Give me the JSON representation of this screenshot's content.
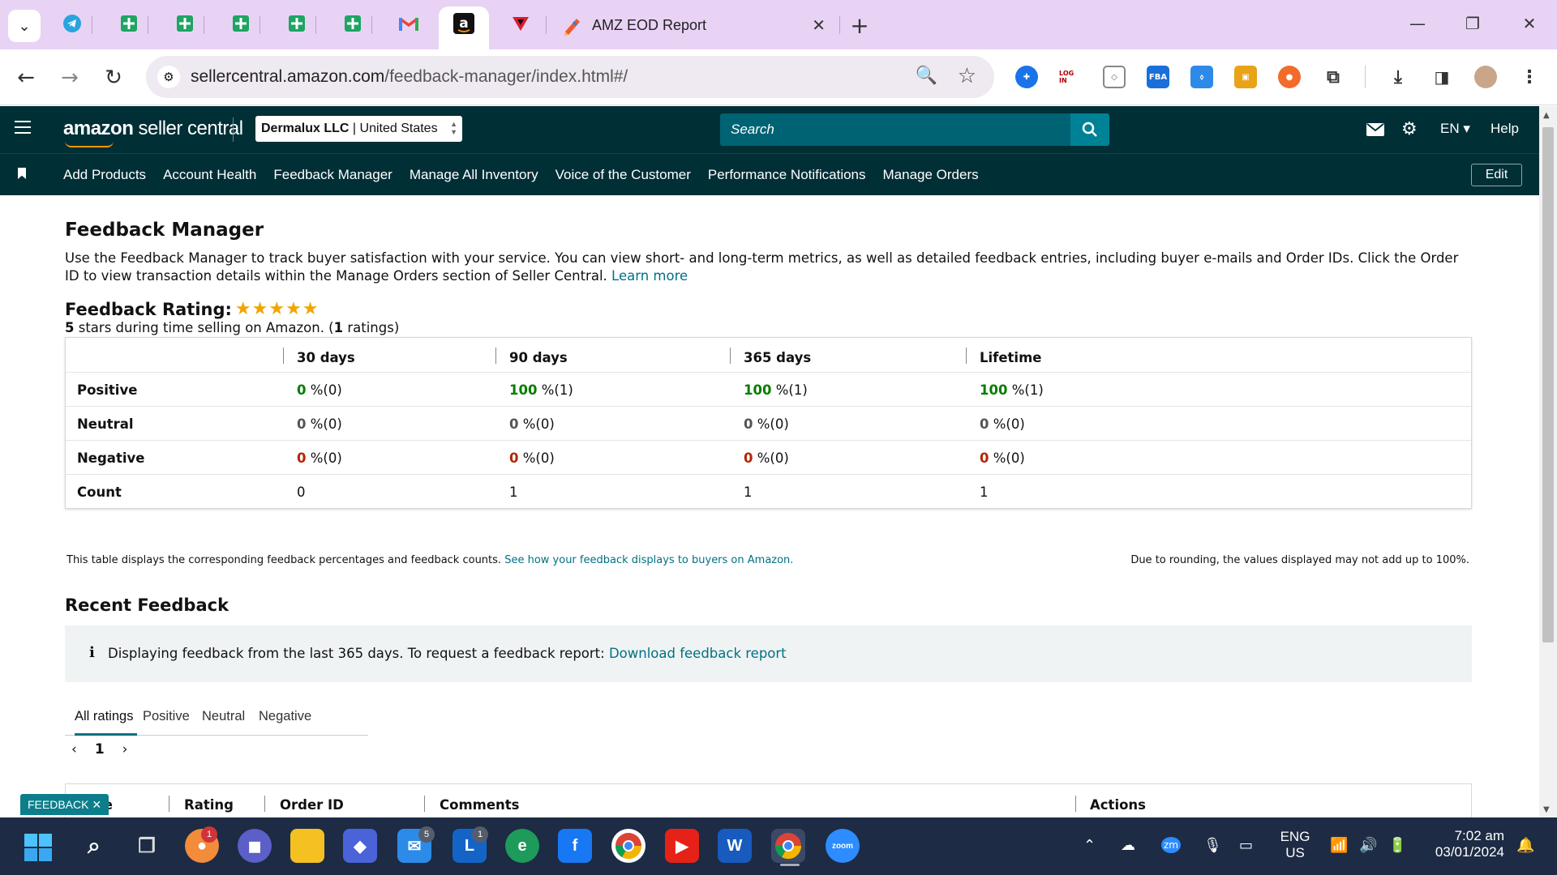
{
  "browser": {
    "active_tab_title": "AMZ EOD Report",
    "url_domain": "sellercentral.amazon.com",
    "url_path": "/feedback-manager/index.html#/"
  },
  "header": {
    "logo_brand": "amazon",
    "logo_product": "seller central",
    "account_name": "Dermalux LLC",
    "account_region": "| United States",
    "search_placeholder": "Search",
    "language": "EN",
    "help": "Help"
  },
  "nav": {
    "links": [
      "Add Products",
      "Account Health",
      "Feedback Manager",
      "Manage All Inventory",
      "Voice of the Customer",
      "Performance Notifications",
      "Manage Orders"
    ],
    "edit": "Edit"
  },
  "page": {
    "title": "Feedback Manager",
    "description": "Use the Feedback Manager to track buyer satisfaction with your service. You can view short- and long-term metrics, as well as detailed feedback entries, including buyer e-mails and Order IDs. Click the Order ID to view transaction details within the Manage Orders section of Seller Central.",
    "learn_more": "Learn more",
    "rating_label": "Feedback Rating:",
    "rating_stars": 5,
    "rating_sub_stars": "5",
    "rating_sub_text": "stars during time selling on Amazon. (",
    "rating_sub_count": "1",
    "rating_sub_end": "ratings)"
  },
  "table": {
    "columns": [
      "30 days",
      "90 days",
      "365 days",
      "Lifetime"
    ],
    "rows": [
      {
        "label": "Positive",
        "values": [
          {
            "n": "0",
            "rest": "%(0)"
          },
          {
            "n": "100",
            "rest": "%(1)"
          },
          {
            "n": "100",
            "rest": "%(1)"
          },
          {
            "n": "100",
            "rest": "%(1)"
          }
        ]
      },
      {
        "label": "Neutral",
        "values": [
          {
            "n": "0",
            "rest": "%(0)"
          },
          {
            "n": "0",
            "rest": "%(0)"
          },
          {
            "n": "0",
            "rest": "%(0)"
          },
          {
            "n": "0",
            "rest": "%(0)"
          }
        ]
      },
      {
        "label": "Negative",
        "values": [
          {
            "n": "0",
            "rest": "%(0)"
          },
          {
            "n": "0",
            "rest": "%(0)"
          },
          {
            "n": "0",
            "rest": "%(0)"
          },
          {
            "n": "0",
            "rest": "%(0)"
          }
        ]
      },
      {
        "label": "Count",
        "values": [
          {
            "n": "",
            "rest": "0"
          },
          {
            "n": "",
            "rest": "1"
          },
          {
            "n": "",
            "rest": "1"
          },
          {
            "n": "",
            "rest": "1"
          }
        ]
      }
    ],
    "note": "This table displays the corresponding feedback percentages and feedback counts.",
    "note_link": "See how your feedback displays to buyers on Amazon.",
    "note_right": "Due to rounding, the values displayed may not add up to 100%."
  },
  "recent": {
    "title": "Recent Feedback",
    "info_text": "Displaying feedback from the last 365 days. To request a feedback report:",
    "info_link": "Download feedback report",
    "tabs": [
      "All ratings",
      "Positive",
      "Neutral",
      "Negative"
    ],
    "page_number": "1",
    "columns": [
      "Date",
      "Rating",
      "Order ID",
      "Comments",
      "Actions"
    ]
  },
  "feedback_tag": "FEEDBACK",
  "taskbar": {
    "lang_top": "ENG",
    "lang_bottom": "US",
    "time": "7:02 am",
    "date": "03/01/2024",
    "badges": {
      "notif": "1",
      "mail": "5",
      "teams": "1"
    }
  },
  "colors": {
    "header_bg": "#002f36",
    "link": "#007185",
    "positive": "#067d00",
    "negative": "#b12704",
    "star": "#f0a500",
    "tabstrip": "#e8d3f5",
    "taskbar": "#1d2b44"
  }
}
